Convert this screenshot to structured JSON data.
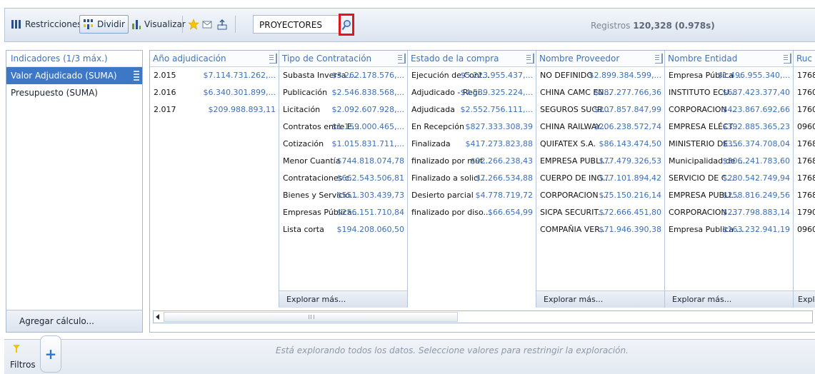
{
  "toolbar": {
    "restricciones_label": "Restricciones",
    "dividir_label": "Dividir",
    "visualizar_label": "Visualizar",
    "search_value": "PROYECTORES",
    "records_prefix": "Registros",
    "records_count": "120,328",
    "records_time": "(0.978s)"
  },
  "indicators": {
    "title": "Indicadores (1/3 máx.)",
    "items": [
      {
        "label": "Valor Adjudicado (SUMA)",
        "selected": true
      },
      {
        "label": "Presupuesto (SUMA)",
        "selected": false
      }
    ],
    "add_label": "Agregar cálculo..."
  },
  "columns": [
    {
      "header": "Año adjudicación",
      "rows": [
        {
          "name": "2.015",
          "value": "$7.114.731.262,..."
        },
        {
          "name": "2.016",
          "value": "$6.340.301.899,..."
        },
        {
          "name": "2.017",
          "value": "$209.988.893,11"
        }
      ],
      "more": ""
    },
    {
      "header": "Tipo de Contratación",
      "rows": [
        {
          "name": "Subasta Inversa ...",
          "value": "$3.262.178.576,..."
        },
        {
          "name": "Publicación",
          "value": "$2.546.838.568,..."
        },
        {
          "name": "Licitación",
          "value": "$2.092.607.928,..."
        },
        {
          "name": "Contratos entre E...",
          "value": "$1.159.000.465,..."
        },
        {
          "name": "Cotización",
          "value": "$1.015.831.711,..."
        },
        {
          "name": "Menor Cuantía",
          "value": "$744.818.074,78"
        },
        {
          "name": "Contrataciones c...",
          "value": "$662.543.506,81"
        },
        {
          "name": "Bienes y Servicio...",
          "value": "$551.303.439,73"
        },
        {
          "name": "Empresas Pública...",
          "value": "$256.151.710,84"
        },
        {
          "name": "Lista corta",
          "value": "$194.208.060,50"
        }
      ],
      "more": "Explorar más..."
    },
    {
      "header": "Estado de la compra",
      "rows": [
        {
          "name": "Ejecución de Cont...",
          "value": "$5.223.955.437,..."
        },
        {
          "name": "Adjudicado - Regi...",
          "value": "$4.539.325.224,..."
        },
        {
          "name": "Adjudicada",
          "value": "$2.552.756.111,..."
        },
        {
          "name": "En Recepción",
          "value": "$827.333.308,39"
        },
        {
          "name": "Finalizada",
          "value": "$417.273.823,88"
        },
        {
          "name": "finalizado por mut...",
          "value": "$92.266.238,43"
        },
        {
          "name": "Finalizado a solici...",
          "value": "$7.266.534,88"
        },
        {
          "name": "Desierto parcial",
          "value": "$4.778.719,72"
        },
        {
          "name": "finalizado por diso...",
          "value": "$66.654,99"
        }
      ],
      "more": ""
    },
    {
      "header": "Nombre Proveedor",
      "rows": [
        {
          "name": "NO DEFINIDO",
          "value": "$2.899.384.599,..."
        },
        {
          "name": "CHINA CAMC EN...",
          "value": "$287.277.766,36"
        },
        {
          "name": "SEGUROS SUCR...",
          "value": "$207.857.847,99"
        },
        {
          "name": "CHINA RAILWAY...",
          "value": "$206.238.572,74"
        },
        {
          "name": "QUIFATEX S.A.",
          "value": "$86.143.474,50"
        },
        {
          "name": "EMPRESA PUBLI...",
          "value": "$77.479.326,53"
        },
        {
          "name": "CUERPO DE ING...",
          "value": "$77.101.894,42"
        },
        {
          "name": "CORPORACION ...",
          "value": "$75.150.216,14"
        },
        {
          "name": "SICPA SECURIT...",
          "value": "$72.666.451,80"
        },
        {
          "name": "COMPAÑIA VER...",
          "value": "$71.946.390,38"
        }
      ],
      "more": "Explorar más..."
    },
    {
      "header": "Nombre Entidad",
      "rows": [
        {
          "name": "Empresa Pública ...",
          "value": "$1.496.955.340,..."
        },
        {
          "name": "INSTITUTO ECU...",
          "value": "$687.423.377,40"
        },
        {
          "name": "CORPORACION ...",
          "value": "$423.867.692,66"
        },
        {
          "name": "EMPRESA ELÉCT...",
          "value": "$392.885.365,23"
        },
        {
          "name": "MINISTERIO DE ...",
          "value": "$356.374.708,04"
        },
        {
          "name": "Municipalidad de ...",
          "value": "$306.241.783,60"
        },
        {
          "name": "SERVICIO DE C...",
          "value": "$280.542.749,94"
        },
        {
          "name": "EMPRESA PUBLI...",
          "value": "$258.816.249,56"
        },
        {
          "name": "CORPORACION ...",
          "value": "$237.798.883,14"
        },
        {
          "name": "Empresa Publica ...",
          "value": "$163.232.941,19"
        }
      ],
      "more": "Explorar más..."
    },
    {
      "header": "Ruc E",
      "rows": [
        {
          "name": "1768",
          "value": ""
        },
        {
          "name": "1760",
          "value": ""
        },
        {
          "name": "1760",
          "value": ""
        },
        {
          "name": "0960",
          "value": ""
        },
        {
          "name": "1768",
          "value": ""
        },
        {
          "name": "1768",
          "value": ""
        },
        {
          "name": "1768",
          "value": ""
        },
        {
          "name": "1768",
          "value": ""
        },
        {
          "name": "1790",
          "value": ""
        },
        {
          "name": "0960",
          "value": ""
        }
      ],
      "more": "Expl"
    }
  ],
  "filters": {
    "label": "Filtros",
    "add_symbol": "+",
    "message": "Está explorando todos los datos. Seleccione valores para restringir la exploración."
  },
  "colors": {
    "header_text": "#4173b5",
    "value_text": "#3e6fb3",
    "selection": "#3d78c6",
    "search_highlight": "#e4141e",
    "star": "#f3c400"
  }
}
